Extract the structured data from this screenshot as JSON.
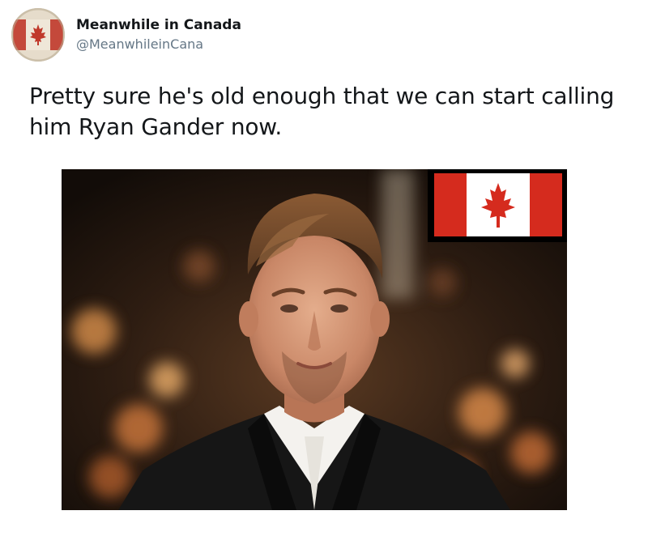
{
  "tweet": {
    "author": {
      "display_name": "Meanwhile in Canada",
      "handle": "@MeanwhileinCana",
      "avatar_icon": "canada-flag-avatar-icon"
    },
    "text": "Pretty sure he's old enough that we can start calling him Ryan Gander now.",
    "media": {
      "description_icon": "photo-with-canada-flag-icon",
      "flag_colors": {
        "red": "#d52b1e",
        "white": "#ffffff"
      }
    }
  },
  "colors": {
    "text_primary": "#14171a",
    "text_secondary": "#657786",
    "background": "#ffffff"
  }
}
